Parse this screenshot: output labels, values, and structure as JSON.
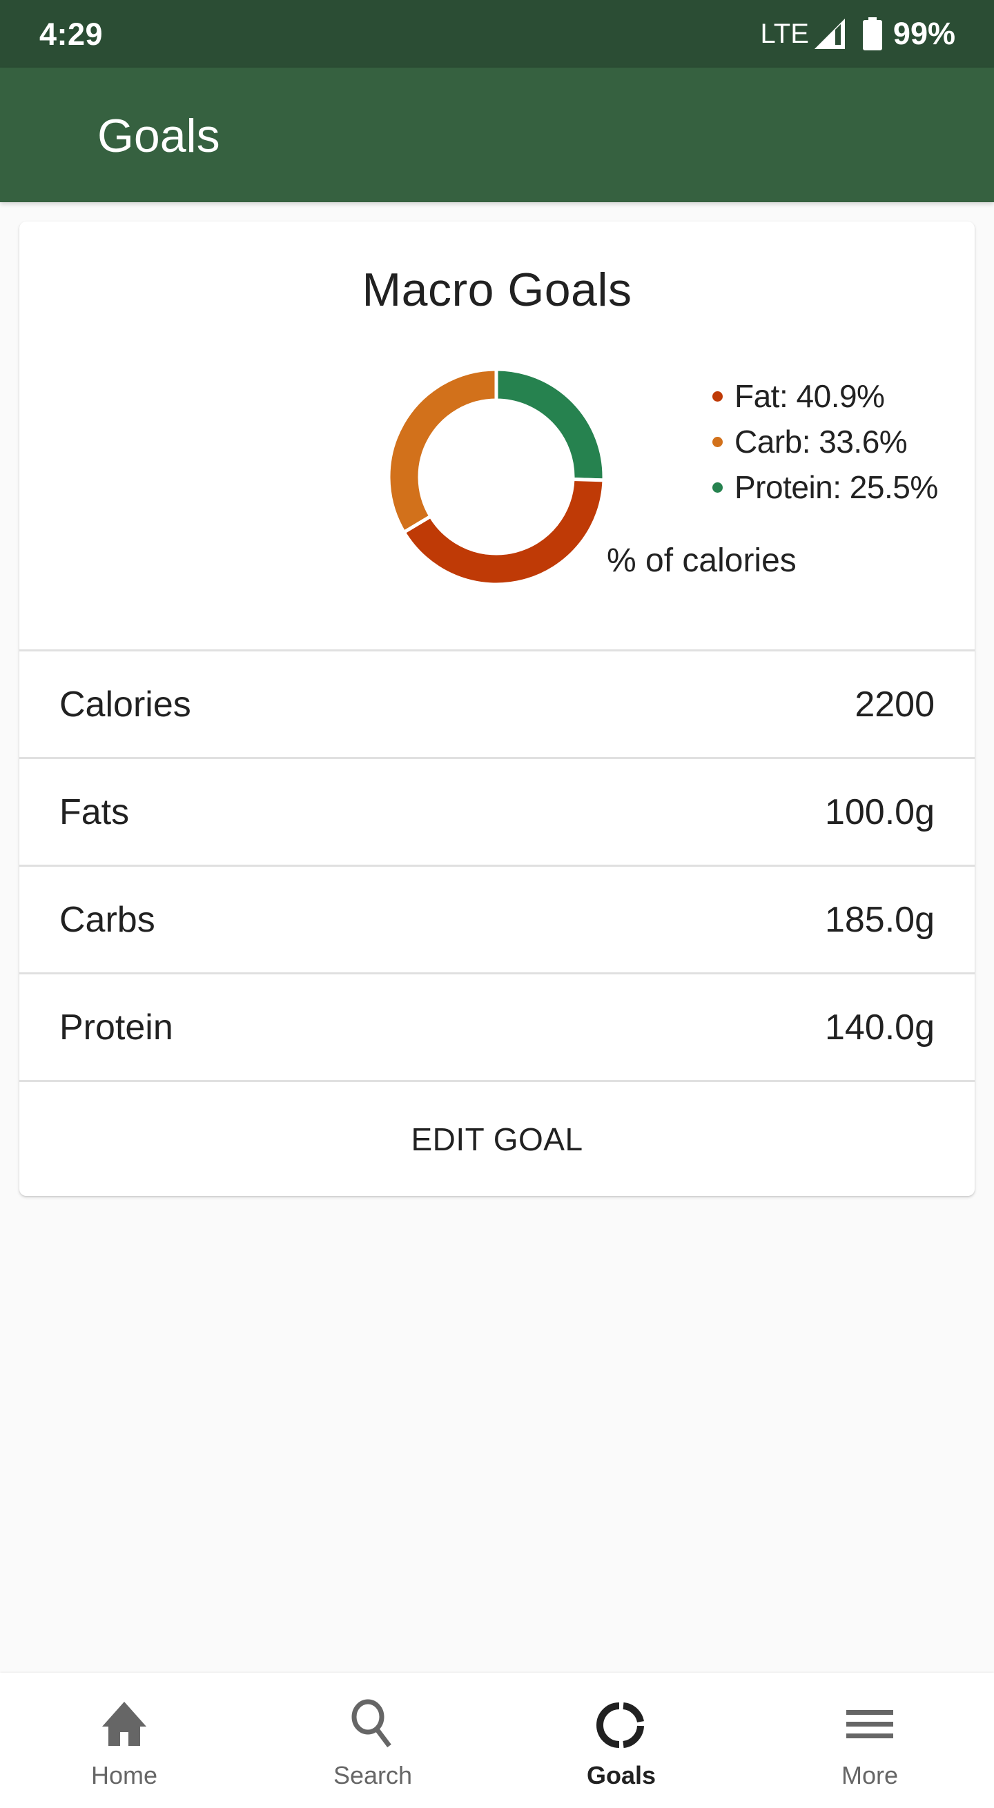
{
  "status_bar": {
    "time": "4:29",
    "network": "LTE",
    "signal_icon": "signal-icon",
    "battery_icon": "battery-icon",
    "battery_percent": "99%"
  },
  "app_bar": {
    "title": "Goals"
  },
  "card": {
    "title": "Macro Goals",
    "chart_caption": "% of calories",
    "legend": [
      {
        "label": "Fat: 40.9%",
        "color": "#bf3a06"
      },
      {
        "label": "Carb: 33.6%",
        "color": "#d2711b"
      },
      {
        "label": "Protein: 25.5%",
        "color": "#26824f"
      }
    ],
    "rows": [
      {
        "label": "Calories",
        "value": "2200"
      },
      {
        "label": "Fats",
        "value": "100.0g"
      },
      {
        "label": "Carbs",
        "value": "185.0g"
      },
      {
        "label": "Protein",
        "value": "140.0g"
      }
    ],
    "edit_button": "EDIT GOAL"
  },
  "chart_data": {
    "type": "pie",
    "title": "Macro Goals",
    "subtitle": "% of calories",
    "donut": true,
    "categories": [
      "Protein",
      "Fat",
      "Carb"
    ],
    "values": [
      25.5,
      40.9,
      33.6
    ],
    "colors": [
      "#26824f",
      "#bf3a06",
      "#d2711b"
    ],
    "start": "12 o'clock",
    "direction": "clockwise",
    "legend_placement": "right"
  },
  "bottom_nav": {
    "items": [
      {
        "label": "Home",
        "icon": "home-icon",
        "active": false
      },
      {
        "label": "Search",
        "icon": "search-icon",
        "active": false
      },
      {
        "label": "Goals",
        "icon": "goals-icon",
        "active": true
      },
      {
        "label": "More",
        "icon": "menu-icon",
        "active": false
      }
    ]
  }
}
